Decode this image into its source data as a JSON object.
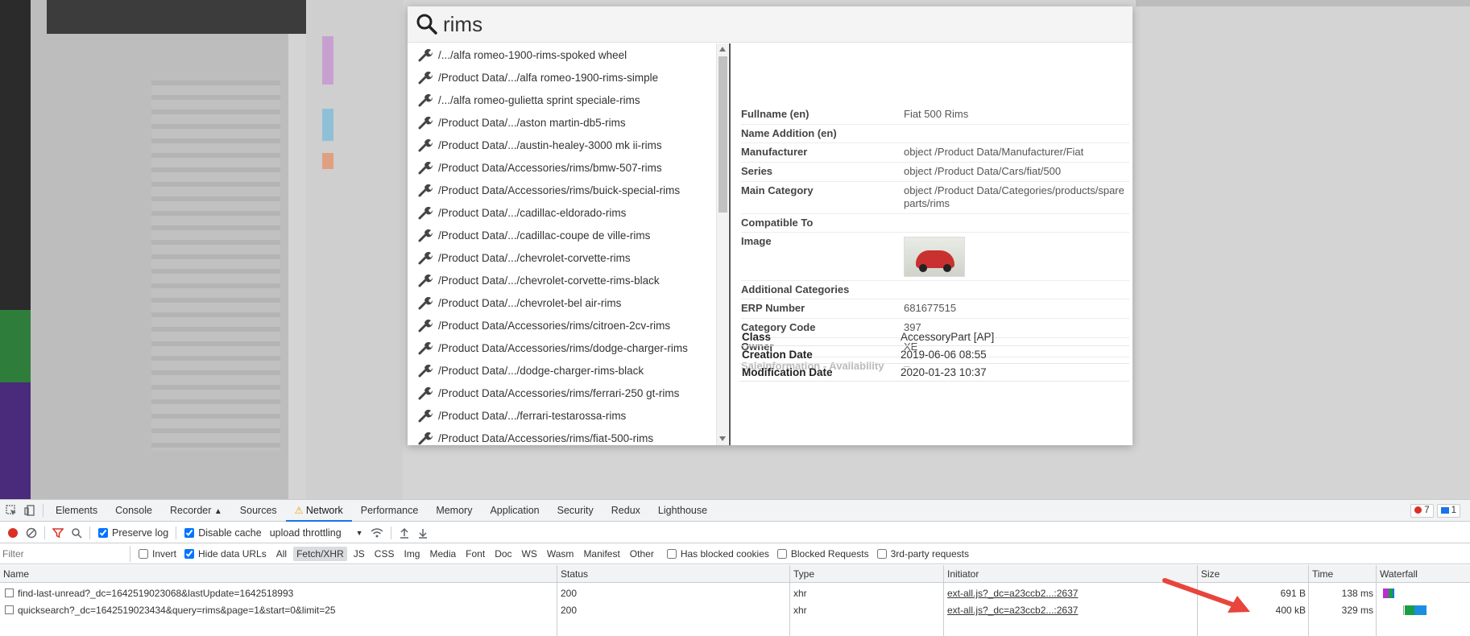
{
  "search": {
    "query": "rims"
  },
  "results": [
    "/.../alfa romeo-1900-rims-spoked wheel",
    "/Product Data/.../alfa romeo-1900-rims-simple",
    "/.../alfa romeo-gulietta sprint speciale-rims",
    "/Product Data/.../aston martin-db5-rims",
    "/Product Data/.../austin-healey-3000 mk ii-rims",
    "/Product Data/Accessories/rims/bmw-507-rims",
    "/Product Data/Accessories/rims/buick-special-rims",
    "/Product Data/.../cadillac-eldorado-rims",
    "/Product Data/.../cadillac-coupe de ville-rims",
    "/Product Data/.../chevrolet-corvette-rims",
    "/Product Data/.../chevrolet-corvette-rims-black",
    "/Product Data/.../chevrolet-bel air-rims",
    "/Product Data/Accessories/rims/citroen-2cv-rims",
    "/Product Data/Accessories/rims/dodge-charger-rims",
    "/Product Data/.../dodge-charger-rims-black",
    "/Product Data/Accessories/rims/ferrari-250 gt-rims",
    "/Product Data/.../ferrari-testarossa-rims",
    "/Product Data/Accessories/rims/fiat-500-rims"
  ],
  "preview": {
    "fields": [
      {
        "key": "Fullname (en)",
        "value": "Fiat 500 Rims"
      },
      {
        "key": "Name Addition (en)",
        "value": ""
      },
      {
        "key": "Manufacturer",
        "value": "object /Product Data/Manufacturer/Fiat"
      },
      {
        "key": "Series",
        "value": "object /Product Data/Cars/fiat/500"
      },
      {
        "key": "Main Category",
        "value": "object /Product Data/Categories/products/spare parts/rims"
      },
      {
        "key": "Compatible To",
        "value": ""
      }
    ],
    "image_label": "Image",
    "fields2": [
      {
        "key": "Additional Categories",
        "value": ""
      },
      {
        "key": "ERP Number",
        "value": "681677515"
      },
      {
        "key": "Category Code",
        "value": "397"
      },
      {
        "key": "Owner",
        "value": "XE"
      }
    ],
    "faded_field": {
      "key": "Saleinformation - Availability",
      "value": "–"
    },
    "meta": [
      {
        "key": "Class",
        "value": "AccessoryPart [AP]"
      },
      {
        "key": "Creation Date",
        "value": "2019-06-06 08:55"
      },
      {
        "key": "Modification Date",
        "value": "2020-01-23 10:37"
      }
    ]
  },
  "devtools": {
    "tabs": [
      "Elements",
      "Console",
      "Recorder",
      "Sources",
      "Network",
      "Performance",
      "Memory",
      "Application",
      "Security",
      "Redux",
      "Lighthouse"
    ],
    "active_tab": "Network",
    "error_count": "7",
    "message_count": "1",
    "toolbar": {
      "preserve_log": "Preserve log",
      "disable_cache": "Disable cache",
      "throttling": "upload throttling"
    },
    "filter": {
      "placeholder": "Filter",
      "invert": "Invert",
      "hide_data_urls": "Hide data URLs",
      "types": [
        "All",
        "Fetch/XHR",
        "JS",
        "CSS",
        "Img",
        "Media",
        "Font",
        "Doc",
        "WS",
        "Wasm",
        "Manifest",
        "Other"
      ],
      "selected_type": "Fetch/XHR",
      "has_blocked_cookies": "Has blocked cookies",
      "blocked_requests": "Blocked Requests",
      "third_party": "3rd-party requests"
    },
    "columns": [
      "Name",
      "Status",
      "Type",
      "Initiator",
      "Size",
      "Time",
      "Waterfall"
    ],
    "rows": [
      {
        "name": "find-last-unread?_dc=1642519023068&lastUpdate=1642518993",
        "status": "200",
        "type": "xhr",
        "initiator": "ext-all.js?_dc=a23ccb2...:2637",
        "size": "691 B",
        "time": "138 ms"
      },
      {
        "name": "quicksearch?_dc=1642519023434&query=rims&page=1&start=0&limit=25",
        "status": "200",
        "type": "xhr",
        "initiator": "ext-all.js?_dc=a23ccb2...:2637",
        "size": "400 kB",
        "time": "329 ms"
      }
    ]
  },
  "colors": {
    "accent": "#1a73e8",
    "annotation_arrow": "#e8453c",
    "record": "#d93025"
  }
}
